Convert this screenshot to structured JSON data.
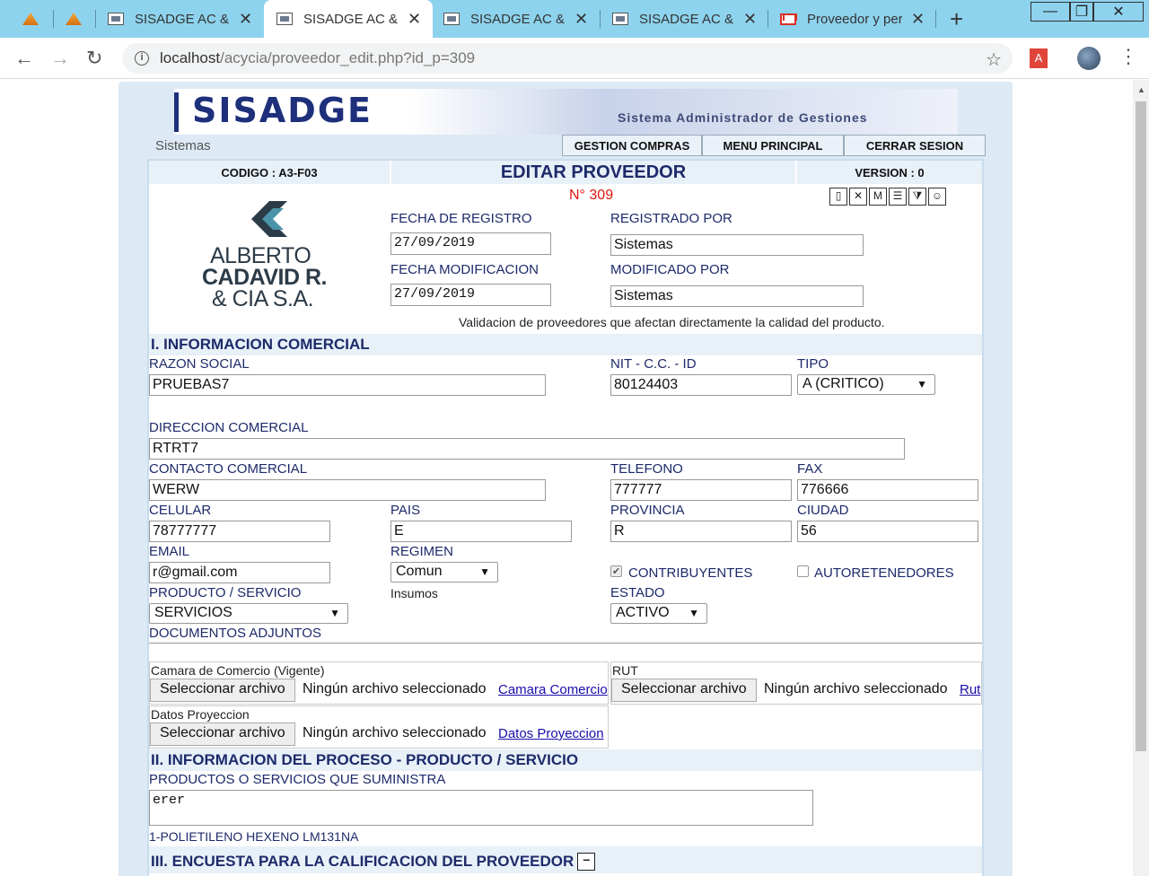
{
  "browser": {
    "tabs": [
      {
        "title": "SISADGE AC & C",
        "active": false
      },
      {
        "title": "SISADGE AC & C",
        "active": true
      },
      {
        "title": "SISADGE AC & C",
        "active": false
      },
      {
        "title": "SISADGE AC & C",
        "active": false
      },
      {
        "title": "Proveedor y per",
        "active": false
      }
    ],
    "url_host": "localhost",
    "url_path": "/acycia/proveedor_edit.php?id_p=309",
    "pdf_label": "A"
  },
  "header": {
    "logo": "SISADGE",
    "subtitle": "Sistema Administrador de Gestiones",
    "user": "Sistemas",
    "nav": [
      "GESTION COMPRAS",
      "MENU PRINCIPAL",
      "CERRAR SESION"
    ]
  },
  "form": {
    "codigo": "CODIGO : A3-F03",
    "title": "EDITAR PROVEEDOR",
    "version": "VERSION : 0",
    "numero": "N° 309",
    "company": [
      "ALBERTO",
      "CADAVID R.",
      "& CIA S.A."
    ],
    "fecha_registro_label": "FECHA DE REGISTRO",
    "fecha_registro": "27/09/2019",
    "registrado_por_label": "REGISTRADO POR",
    "registrado_por": "Sistemas",
    "fecha_mod_label": "FECHA MODIFICACION",
    "fecha_mod": "27/09/2019",
    "modificado_por_label": "MODIFICADO POR",
    "modificado_por": "Sistemas",
    "validacion": "Validacion de proveedores que afectan directamente la calidad del producto."
  },
  "sections": {
    "s1": "I. INFORMACION COMERCIAL",
    "s2": "II. INFORMACION DEL PROCESO - PRODUCTO / SERVICIO",
    "s3": "III. ENCUESTA PARA LA CALIFICACION DEL PROVEEDOR"
  },
  "comercial": {
    "razon_label": "RAZON SOCIAL",
    "razon": "PRUEBAS7",
    "nit_label": "NIT - C.C. - ID",
    "nit": "80124403",
    "tipo_label": "TIPO",
    "tipo": "A (CRITICO)",
    "direccion_label": "DIRECCION COMERCIAL",
    "direccion": "RTRT7",
    "contacto_label": "CONTACTO COMERCIAL",
    "contacto": "WERW",
    "telefono_label": "TELEFONO",
    "telefono": "777777",
    "fax_label": "FAX",
    "fax": "776666",
    "celular_label": "CELULAR",
    "celular": "78777777",
    "pais_label": "PAIS",
    "pais": "E",
    "provincia_label": "PROVINCIA",
    "provincia": "R",
    "ciudad_label": "CIUDAD",
    "ciudad": "56",
    "email_label": "EMAIL",
    "email": "r@gmail.com",
    "regimen_label": "REGIMEN",
    "regimen": "Comun",
    "contribuyentes_label": "CONTRIBUYENTES",
    "autoretenedores_label": "AUTORETENEDORES",
    "producto_label": "PRODUCTO / SERVICIO",
    "producto": "SERVICIOS",
    "insumos": "Insumos",
    "estado_label": "ESTADO",
    "estado": "ACTIVO",
    "documentos_label": "DOCUMENTOS ADJUNTOS"
  },
  "documentos": {
    "camara_label": "Camara de Comercio (Vigente)",
    "rut_label": "RUT",
    "datos_label": "Datos Proyeccion",
    "btn": "Seleccionar archivo",
    "none": "Ningún archivo seleccionado",
    "camara_link": "Camara Comercio",
    "rut_link": "Rut",
    "datos_link": "Datos Proyeccion"
  },
  "proceso": {
    "label": "PRODUCTOS O SERVICIOS QUE SUMINISTRA",
    "value": "erer",
    "item": "1-POLIETILENO HEXENO LM131NA"
  }
}
